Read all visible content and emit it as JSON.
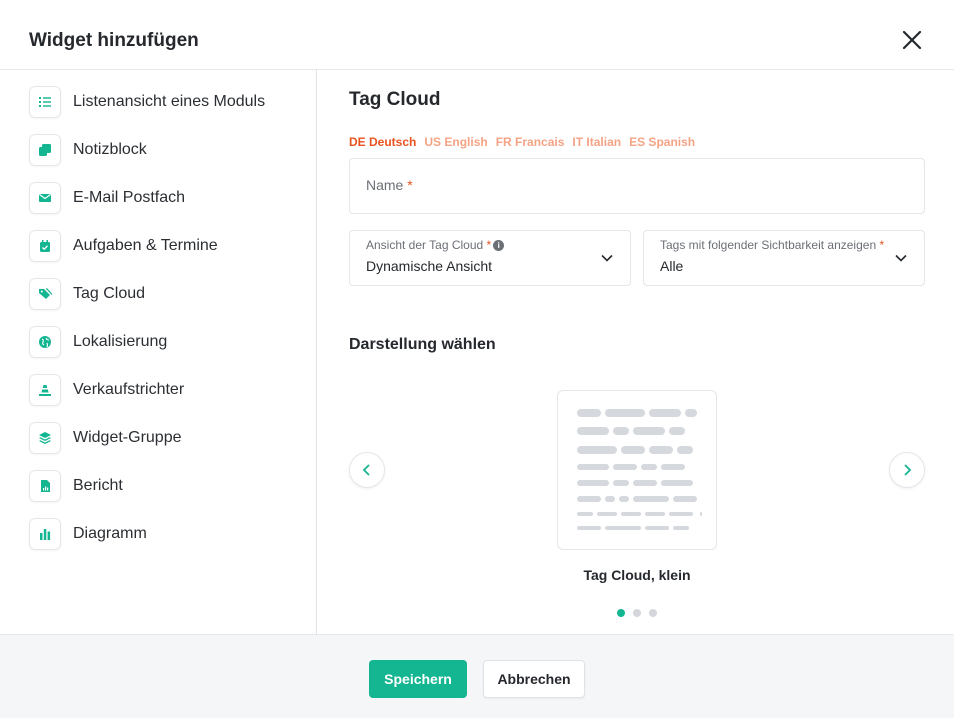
{
  "dialog": {
    "title": "Widget hinzufügen"
  },
  "colors": {
    "accent": "#14b591",
    "lang_active": "#e8531f",
    "lang_inactive": "#f5a385",
    "required": "#e8531f"
  },
  "sidebar": {
    "items": [
      {
        "label": "Listenansicht eines Moduls",
        "icon": "list-icon"
      },
      {
        "label": "Notizblock",
        "icon": "notes-icon"
      },
      {
        "label": "E-Mail Postfach",
        "icon": "envelope-icon"
      },
      {
        "label": "Aufgaben & Termine",
        "icon": "calendar-check-icon"
      },
      {
        "label": "Tag Cloud",
        "icon": "tags-icon"
      },
      {
        "label": "Lokalisierung",
        "icon": "globe-icon"
      },
      {
        "label": "Verkaufstrichter",
        "icon": "funnel-icon"
      },
      {
        "label": "Widget-Gruppe",
        "icon": "layers-icon"
      },
      {
        "label": "Bericht",
        "icon": "report-icon"
      },
      {
        "label": "Diagramm",
        "icon": "bar-chart-icon"
      }
    ]
  },
  "main": {
    "title": "Tag Cloud",
    "languages": [
      {
        "label": "DE Deutsch",
        "active": true
      },
      {
        "label": "US English",
        "active": false
      },
      {
        "label": "FR Francais",
        "active": false
      },
      {
        "label": "IT Italian",
        "active": false
      },
      {
        "label": "ES Spanish",
        "active": false
      }
    ],
    "name_field": {
      "placeholder": "Name",
      "required_mark": "*"
    },
    "view_select": {
      "label": "Ansicht der Tag Cloud",
      "required_mark": "*",
      "info_glyph": "i",
      "value": "Dynamische Ansicht"
    },
    "visibility_select": {
      "label": "Tags mit folgender Sichtbarkeit anzeigen",
      "required_mark": "*",
      "value": "Alle"
    },
    "display": {
      "title": "Darstellung wählen",
      "preview_caption": "Tag Cloud, klein",
      "slide_count": 3,
      "active_slide": 0
    }
  },
  "footer": {
    "save_label": "Speichern",
    "cancel_label": "Abbrechen"
  }
}
